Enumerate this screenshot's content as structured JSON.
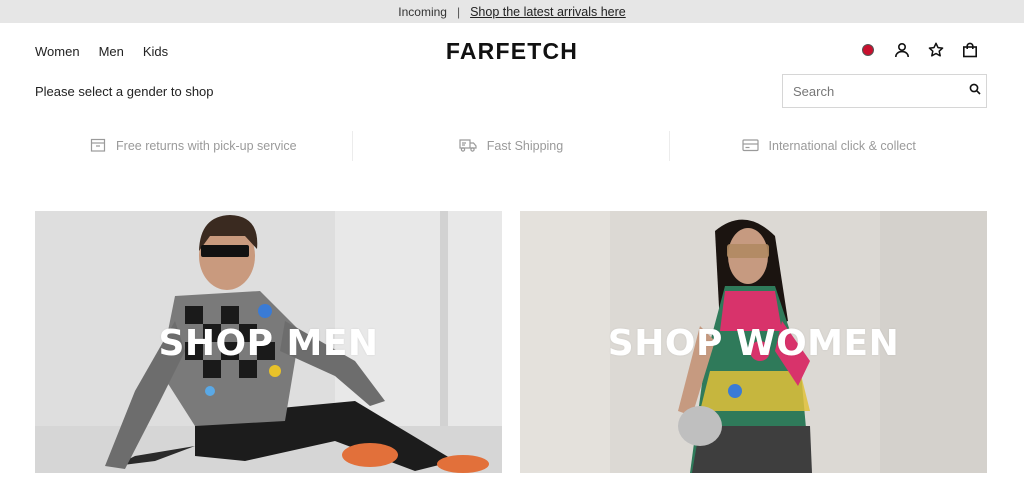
{
  "promo": {
    "incoming": "Incoming",
    "separator": "|",
    "link": "Shop the latest arrivals here"
  },
  "nav": {
    "women": "Women",
    "men": "Men",
    "kids": "Kids"
  },
  "brand": {
    "logo": "FARFETCH"
  },
  "header_icons": [
    "region-flag-icon",
    "account-icon",
    "wishlist-star-icon",
    "shopping-bag-icon"
  ],
  "gender_prompt": "Please select a gender to shop",
  "search": {
    "placeholder": "Search",
    "value": ""
  },
  "services": [
    {
      "icon": "returns-box-icon",
      "label": "Free returns with pick-up service"
    },
    {
      "icon": "truck-icon",
      "label": "Fast Shipping"
    },
    {
      "icon": "card-icon",
      "label": "International click & collect"
    }
  ],
  "cards": {
    "men": {
      "label": "SHOP MEN"
    },
    "women": {
      "label": "SHOP WOMEN"
    }
  },
  "colors": {
    "promo_bg": "#e6e6e6",
    "flag": "#c8102e",
    "service_text": "#9a9a9a"
  }
}
